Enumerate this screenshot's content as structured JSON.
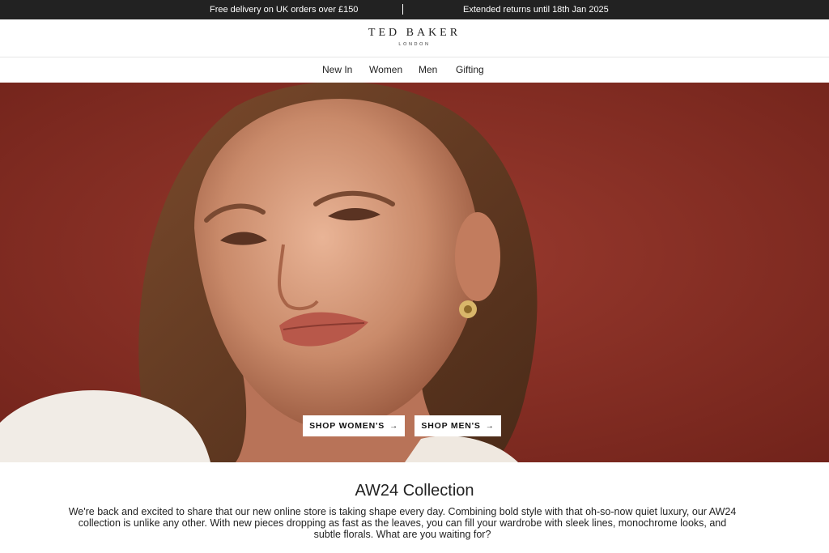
{
  "promo": {
    "left": "Free delivery on UK orders over £150",
    "right": "Extended returns until 18th Jan 2025"
  },
  "brand": {
    "name": "TED BAKER",
    "sub": "LONDON"
  },
  "nav": {
    "items": [
      {
        "label": "New In"
      },
      {
        "label": "Women"
      },
      {
        "label": "Men"
      },
      {
        "label": "Gifting"
      }
    ]
  },
  "hero": {
    "cta_women": "SHOP WOMEN'S",
    "cta_men": "SHOP MEN'S",
    "arrow_icon": "arrow-right-icon",
    "background_color": "#8a2e25"
  },
  "collection": {
    "title": "AW24 Collection",
    "body": "We're back and excited to share that our new online store is taking shape every day. Combining bold style with that oh-so-now quiet luxury, our AW24 collection is unlike any other. With new pieces dropping as fast as the leaves, you can fill your wardrobe with sleek lines, monochrome looks, and subtle florals. What are you waiting for?"
  }
}
